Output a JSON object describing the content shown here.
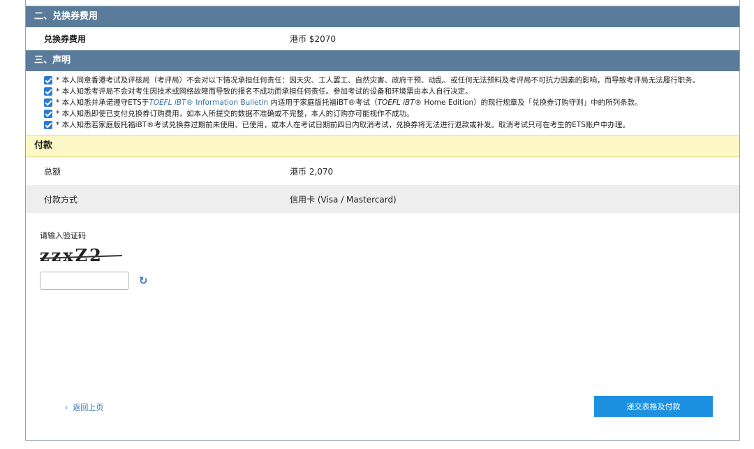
{
  "voucher_fee": {
    "section_title": "二、兑换券费用",
    "label": "兑换券费用",
    "value": "港币 $2070"
  },
  "declaration": {
    "section_title": "三、声明",
    "items": [
      {
        "text": "* 本人同意香港考试及评核局（考评局）不会对以下情况承担任何责任：因天灾、工人罢工、自然灾害、政府干预、动乱、或任何无法预料及考评局不可抗力因素的影响，而导致考评局无法履行职务。"
      },
      {
        "text": "* 本人知悉考评局不会对考生因技术或网络故障而导致的报名不成功而承担任何责任。参加考试的设备和环境需由本人自行决定。"
      },
      {
        "part1": "* 本人知悉并承诺遵守ETS于",
        "link_italic": "TOEFL iBT®",
        "link_text": " Information Bulletin",
        "part2": " 内适用于家庭版托福iBT®考试（",
        "italic2": "TOEFL iBT®",
        "part3": " Home Edition）的现行规章及「兑换券订购守则」中的所列条款。"
      },
      {
        "text": "* 本人知悉即使已支付兑换券订购费用，如本人所提交的数据不准确或不完整，本人的订购亦可能视作不成功。"
      },
      {
        "text": "* 本人知悉若家庭版托福iBT®考试兑换券过期前未使用、已使用，或本人在考试日期前四日内取消考试，兑换券将无法进行退款或补发。取消考试只可在考生的ETS账户中办理。"
      }
    ]
  },
  "payment": {
    "section_title": "付款",
    "total_label": "总额",
    "total_value": "港币 2,070",
    "method_label": "付款方式",
    "method_value": "信用卡 (Visa / Mastercard)"
  },
  "captcha": {
    "label": "请输入验证码",
    "image_text": "zzxZ2",
    "input_value": "",
    "refresh_icon": "refresh-icon"
  },
  "footer": {
    "back_label": "返回上页",
    "submit_label": "递交表格及付款"
  }
}
